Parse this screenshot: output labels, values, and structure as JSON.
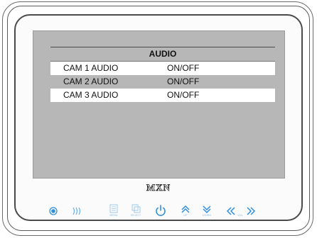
{
  "device": {
    "brand": "MXN"
  },
  "menu": {
    "title": "AUDIO",
    "rows": [
      {
        "label": "CAM 1 AUDIO",
        "value": "ON/OFF",
        "highlighted": true
      },
      {
        "label": "CAM 2 AUDIO",
        "value": "ON/OFF",
        "highlighted": false
      },
      {
        "label": "CAM 3 AUDIO",
        "value": "ON/OFF",
        "highlighted": true
      }
    ]
  },
  "buttons": {
    "menu_caption": "MENU",
    "select_caption": "SELECT",
    "up_caption": "UP",
    "down_caption": "DOWN",
    "vol_caption": "VOL"
  },
  "colors": {
    "icon_blue": "#2f8fdc",
    "screen_bg": "#b7b7b7",
    "highlight": "#ffffff"
  }
}
